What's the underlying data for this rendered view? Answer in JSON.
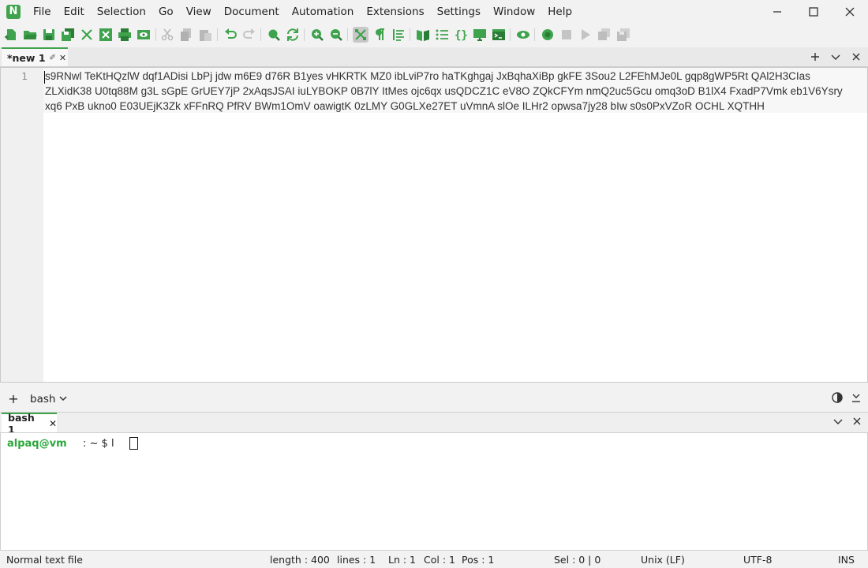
{
  "app": {
    "logo_letter": "N"
  },
  "menu": [
    "File",
    "Edit",
    "Selection",
    "Go",
    "View",
    "Document",
    "Automation",
    "Extensions",
    "Settings",
    "Window",
    "Help"
  ],
  "colors": {
    "accent": "#3fa34d",
    "prompt_user": "#2aa83a"
  },
  "editor": {
    "tab_label": "*new 1",
    "line_number": "1",
    "text": "s9RNwl TeKtHQzlW dqf1ADisi LbPj jdw m6E9 d76R B1yes vHKRTK MZ0 ibLviP7ro haTKghgaj JxBqhaXiBp gkFE 3Sou2 L2FEhMJe0L gqp8gWP5Rt QAl2H3CIas ZLXidK38 U0tq88M g3L sGpE GrUEY7jP 2xAqsJSAI iuLYBOKP 0B7lY ItMes ojc6qx usQDCZ1C eV8O ZQkCFYm nmQ2uc5Gcu omq3oD B1lX4 FxadP7Vmk eb1V6Ysry xq6 PxB ukno0 E03UEjK3Zk xFFnRQ PfRV BWm1OmV oawigtK 0zLMY G0GLXe27ET uVmnA slOe ILHr2 opwsa7jy28 bIw s0s0PxVZoR OCHL XQTHH"
  },
  "panel": {
    "add_label": "+",
    "shell_label": "bash"
  },
  "terminal": {
    "tab_label": "bash 1",
    "prompt_user": "alpaq@vm",
    "prompt_rest": ": ~ $ l"
  },
  "status": {
    "file_type": "Normal text file",
    "length": "length : 400",
    "lines": "lines : 1",
    "ln": "Ln : 1",
    "col": "Col : 1",
    "pos": "Pos : 1",
    "sel": "Sel : 0 | 0",
    "eol": "Unix (LF)",
    "encoding": "UTF-8",
    "mode": "INS"
  }
}
